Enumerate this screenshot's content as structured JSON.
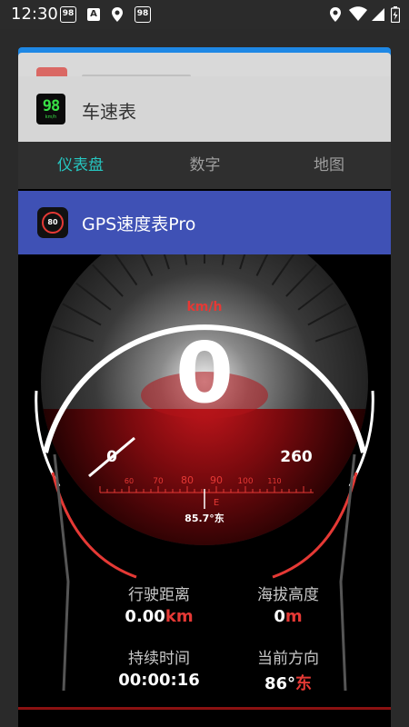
{
  "status_bar": {
    "time": "12:30",
    "left_icons": [
      "app-98-icon",
      "a-icon",
      "location-icon",
      "app-98-icon"
    ],
    "right_icons": [
      "location-icon",
      "wifi-icon",
      "signal-icon",
      "battery-icon"
    ],
    "badge_text": "98",
    "a_text": "A"
  },
  "recents": {
    "card_title": "车速表",
    "icon_number": "98",
    "icon_unit": "km/h"
  },
  "tabs": [
    "仪表盘",
    "数字",
    "地图"
  ],
  "active_tab": 0,
  "app_bar": {
    "title": "GPS速度表Pro",
    "icon_number": "80"
  },
  "gauge": {
    "unit": "km/h",
    "speed": "0",
    "min_label": "0",
    "max_label": "260",
    "speed_value": 0,
    "compass_labels": [
      "60",
      "70",
      "80",
      "90",
      "100",
      "110"
    ],
    "compass_letter": "E",
    "heading_readout": "85.7°东"
  },
  "stats": {
    "distance": {
      "label": "行驶距离",
      "value": "0.00",
      "unit": "km"
    },
    "altitude": {
      "label": "海拔高度",
      "value": "0",
      "unit": "m"
    },
    "duration": {
      "label": "持续时间",
      "value": "00:00:16",
      "unit": ""
    },
    "heading": {
      "label": "当前方向",
      "value": "86°",
      "unit": "东"
    }
  },
  "colors": {
    "accent_teal": "#26c6c0",
    "app_bar_blue": "#3f51b5",
    "gauge_red": "#e53935"
  }
}
